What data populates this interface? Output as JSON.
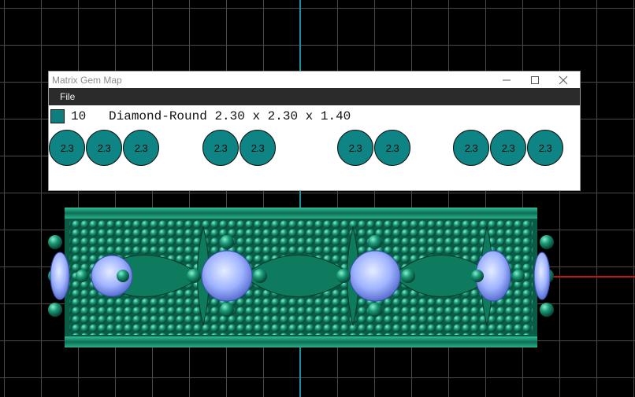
{
  "window": {
    "title": "Matrix Gem Map",
    "minimize_icon": "minimize-icon",
    "maximize_icon": "maximize-icon",
    "close_icon": "close-icon"
  },
  "menu": {
    "file_label": "File"
  },
  "gem_group": {
    "swatch_color": "#0d7f7f",
    "count": "10",
    "description": "Diamond-Round 2.30 x 2.30 x 1.40",
    "stones": [
      "2.3",
      "2.3",
      "2.3",
      "2.3",
      "2.3",
      "2.3",
      "2.3",
      "2.3",
      "2.3",
      "2.3"
    ]
  },
  "colors": {
    "viewport_bg": "#000000",
    "grid": "#4a4a4a",
    "y_axis": "#1f8fa0",
    "x_axis": "#c01818",
    "metal": "#148f6e",
    "gem_fill": "#0f8484",
    "diamond": "#9fb3ff"
  }
}
